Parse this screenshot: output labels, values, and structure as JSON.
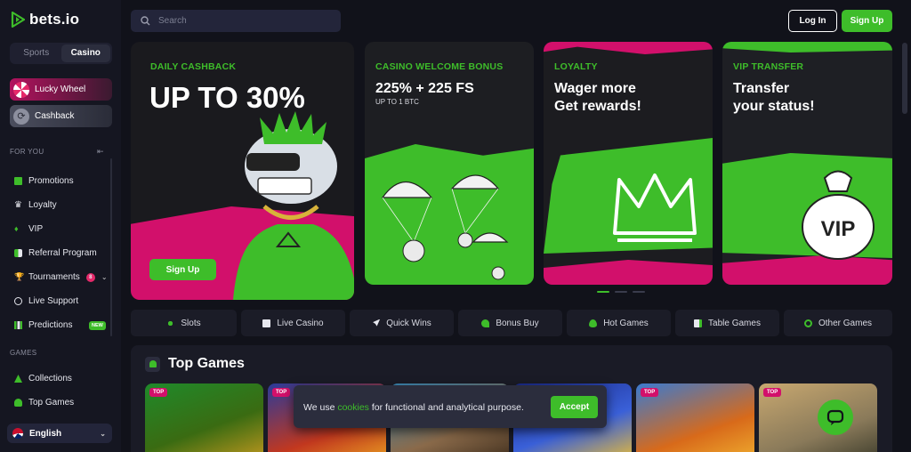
{
  "brand": {
    "name": "bets.io"
  },
  "sidebar": {
    "tabs": [
      "Sports",
      "Casino"
    ],
    "promos": [
      "Lucky Wheel",
      "Cashback"
    ],
    "for_you_label": "FOR YOU",
    "for_you_items": [
      {
        "label": "Promotions",
        "icon": "gift-icon"
      },
      {
        "label": "Loyalty",
        "icon": "crown-icon"
      },
      {
        "label": "VIP",
        "icon": "vip-icon"
      },
      {
        "label": "Referral Program",
        "icon": "users-icon"
      },
      {
        "label": "Tournaments",
        "icon": "trophy-icon",
        "badge": "8"
      },
      {
        "label": "Live Support",
        "icon": "support-icon"
      },
      {
        "label": "Predictions",
        "icon": "chart-icon",
        "badge": "NEW"
      }
    ],
    "games_label": "GAMES",
    "games_items": [
      {
        "label": "Collections",
        "icon": "collections-icon"
      },
      {
        "label": "Top Games",
        "icon": "top-games-icon"
      }
    ],
    "language": "English"
  },
  "header": {
    "search_placeholder": "Search",
    "login": "Log In",
    "signup": "Sign Up"
  },
  "banners": [
    {
      "tag": "DAILY CASHBACK",
      "headline": "UP TO 30%",
      "cta": "Sign Up"
    },
    {
      "tag": "CASINO WELCOME BONUS",
      "headline": "225% + 225 FS",
      "sub": "UP TO 1 BTC"
    },
    {
      "tag": "LOYALTY",
      "headline_1": "Wager more",
      "headline_2": "Get rewards!"
    },
    {
      "tag": "VIP TRANSFER",
      "headline_1": "Transfer",
      "headline_2": "your status!"
    }
  ],
  "categories": [
    "Slots",
    "Live Casino",
    "Quick Wins",
    "Bonus Buy",
    "Hot Games",
    "Table Games",
    "Other Games"
  ],
  "games_section": {
    "title": "Top Games",
    "tile_tag": "TOP"
  },
  "cookie": {
    "before": "We use ",
    "link": "cookies",
    "after": " for functional and analytical purpose.",
    "accept": "Accept"
  },
  "colors": {
    "accent": "#3ebd2a",
    "pink": "#d2106b",
    "bg": "#11121a"
  }
}
